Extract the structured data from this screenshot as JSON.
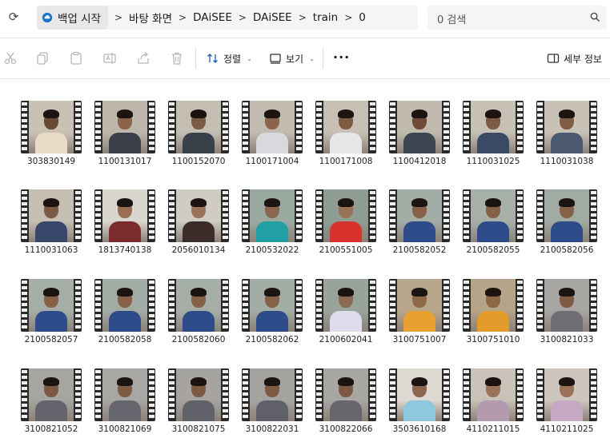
{
  "address": {
    "refresh_icon": "refresh-icon",
    "home_label": "백업 시작",
    "crumbs": [
      "바탕 화면",
      "DAiSEE",
      "DAiSEE",
      "train",
      "0"
    ],
    "search_placeholder": "0 검색"
  },
  "toolbar": {
    "sort_label": "정렬",
    "view_label": "보기",
    "more_label": "···",
    "details_label": "세부 정보"
  },
  "files": [
    {
      "name": "303830149",
      "wall": "#c9c1b3",
      "skin": "#6b4a34",
      "shirt": "#e8dcc8"
    },
    {
      "name": "1100131017",
      "wall": "#bdb6ab",
      "skin": "#8a6248",
      "shirt": "#3a3e48"
    },
    {
      "name": "1100152070",
      "wall": "#c4bdb2",
      "skin": "#7d5a44",
      "shirt": "#38404a"
    },
    {
      "name": "1100171004",
      "wall": "#c2bbb0",
      "skin": "#8b644b",
      "shirt": "#d7d9dd"
    },
    {
      "name": "1100171008",
      "wall": "#c6bfb4",
      "skin": "#7f5b43",
      "shirt": "#e6e6e8"
    },
    {
      "name": "1100412018",
      "wall": "#c0b9ae",
      "skin": "#6e4c36",
      "shirt": "#3b4650"
    },
    {
      "name": "1110031025",
      "wall": "#c7c0b5",
      "skin": "#7e5a45",
      "shirt": "#3a4a66"
    },
    {
      "name": "1110031038",
      "wall": "#c8c1b6",
      "skin": "#805c46",
      "shirt": "#4b5a70"
    },
    {
      "name": "1110031063",
      "wall": "#c5beb3",
      "skin": "#7a5843",
      "shirt": "#37486a"
    },
    {
      "name": "1813740138",
      "wall": "#d9d5cf",
      "skin": "#9a6e53",
      "shirt": "#7a2c2c"
    },
    {
      "name": "2056010134",
      "wall": "#d0ccc4",
      "skin": "#9b7358",
      "shirt": "#3c2c2a"
    },
    {
      "name": "2100532022",
      "wall": "#9aa9a0",
      "skin": "#8a6650",
      "shirt": "#22a1a5"
    },
    {
      "name": "2100551005",
      "wall": "#8e9c93",
      "skin": "#9a7256",
      "shirt": "#d8322c"
    },
    {
      "name": "2100582052",
      "wall": "#a3ada6",
      "skin": "#856148",
      "shirt": "#2e4c8a"
    },
    {
      "name": "2100582055",
      "wall": "#a6b0a9",
      "skin": "#856148",
      "shirt": "#2e4c8a"
    },
    {
      "name": "2100582056",
      "wall": "#a1aba4",
      "skin": "#856148",
      "shirt": "#2e4c8a"
    },
    {
      "name": "2100582057",
      "wall": "#a4aea7",
      "skin": "#856148",
      "shirt": "#2e4c8a"
    },
    {
      "name": "2100582058",
      "wall": "#a2aca5",
      "skin": "#856148",
      "shirt": "#2e4c8a"
    },
    {
      "name": "2100582060",
      "wall": "#a5afa8",
      "skin": "#856148",
      "shirt": "#2e4c8a"
    },
    {
      "name": "2100582062",
      "wall": "#a3ada6",
      "skin": "#856148",
      "shirt": "#2e4c8a"
    },
    {
      "name": "2100602041",
      "wall": "#98a39c",
      "skin": "#8b6a52",
      "shirt": "#dcdcea"
    },
    {
      "name": "3100751007",
      "wall": "#b7a68a",
      "skin": "#8f6848",
      "shirt": "#e8a030"
    },
    {
      "name": "3100751010",
      "wall": "#b5a488",
      "skin": "#8f6848",
      "shirt": "#e39b2c"
    },
    {
      "name": "3100821033",
      "wall": "#a8a6a2",
      "skin": "#7d5a44",
      "shirt": "#6e6e74"
    },
    {
      "name": "3100821052",
      "wall": "#a7a5a1",
      "skin": "#7d5a44",
      "shirt": "#64646c"
    },
    {
      "name": "3100821069",
      "wall": "#a9a7a3",
      "skin": "#7d5a44",
      "shirt": "#66666e"
    },
    {
      "name": "3100821075",
      "wall": "#a6a4a0",
      "skin": "#7d5a44",
      "shirt": "#62626a"
    },
    {
      "name": "3100822031",
      "wall": "#a5a3a0",
      "skin": "#7d5a44",
      "shirt": "#60606a"
    },
    {
      "name": "3100822066",
      "wall": "#a8a6a3",
      "skin": "#7d5a44",
      "shirt": "#66666c"
    },
    {
      "name": "3503610168",
      "wall": "#ddd9d2",
      "skin": "#8a6650",
      "shirt": "#8ec8de"
    },
    {
      "name": "4110211015",
      "wall": "#c9c2b8",
      "skin": "#9a7258",
      "shirt": "#b49aae"
    },
    {
      "name": "4110211025",
      "wall": "#cdc6bc",
      "skin": "#9a7258",
      "shirt": "#c6a8c4"
    }
  ]
}
